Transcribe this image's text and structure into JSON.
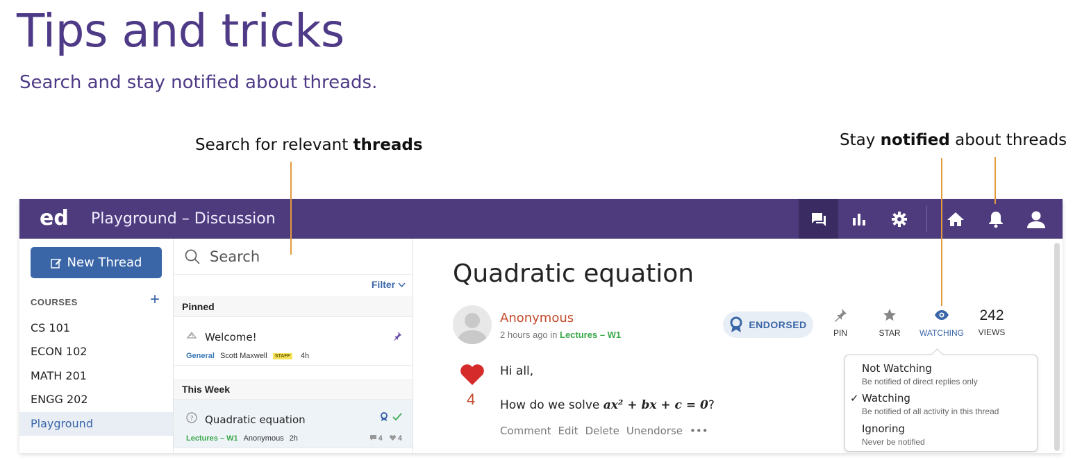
{
  "page": {
    "title": "Tips and tricks",
    "subtitle": "Search and stay notified about threads."
  },
  "callouts": {
    "search_prefix": "Search for relevant ",
    "search_bold": "threads",
    "notify_prefix": "Stay ",
    "notify_bold": "notified",
    "notify_suffix": " about threads",
    "line_color": "#e39a3d"
  },
  "topbar": {
    "logo": "ed",
    "title": "Playground – Discussion",
    "icons": [
      "discussion-icon",
      "analytics-icon",
      "settings-icon",
      "home-icon",
      "bell-icon",
      "user-icon"
    ],
    "color": "#4d3b7e"
  },
  "sidebar": {
    "new_thread_label": "New Thread",
    "courses_header": "COURSES",
    "courses_add": "+",
    "courses": [
      "CS 101",
      "ECON 102",
      "MATH 201",
      "ENGG 202",
      "Playground"
    ],
    "selected": "Playground"
  },
  "threads": {
    "search_placeholder": "Search",
    "filter_label": "Filter",
    "pinned_label": "Pinned",
    "this_week_label": "This Week",
    "items": [
      {
        "title": "Welcome!",
        "category": "General",
        "author": "Scott Maxwell",
        "badge": "STAFF",
        "time": "4h"
      },
      {
        "title": "Quadratic equation",
        "category": "Lectures – W1",
        "author": "Anonymous",
        "time": "2h",
        "comments": "4",
        "likes": "4"
      }
    ]
  },
  "post": {
    "title": "Quadratic equation",
    "author": "Anonymous",
    "time_prefix": "2 hours ago in ",
    "category": "Lectures – W1",
    "endorsed_label": "ENDORSED",
    "pin_label": "PIN",
    "star_label": "STAR",
    "watching_label": "WATCHING",
    "views_value": "242",
    "views_label": "VIEWS",
    "likes": "4",
    "body_line1": "Hi all,",
    "body_line2_prefix": "How do we solve ",
    "body_math": "ax² + bx + c = 0",
    "body_line2_suffix": "?",
    "actions": [
      "Comment",
      "Edit",
      "Delete",
      "Unendorse",
      "•••"
    ]
  },
  "watch_menu": {
    "options": [
      {
        "title": "Not Watching",
        "desc": "Be notified of direct replies only"
      },
      {
        "title": "Watching",
        "desc": "Be notified of all activity in this thread",
        "checked": "✓"
      },
      {
        "title": "Ignoring",
        "desc": "Never be notified"
      }
    ]
  }
}
